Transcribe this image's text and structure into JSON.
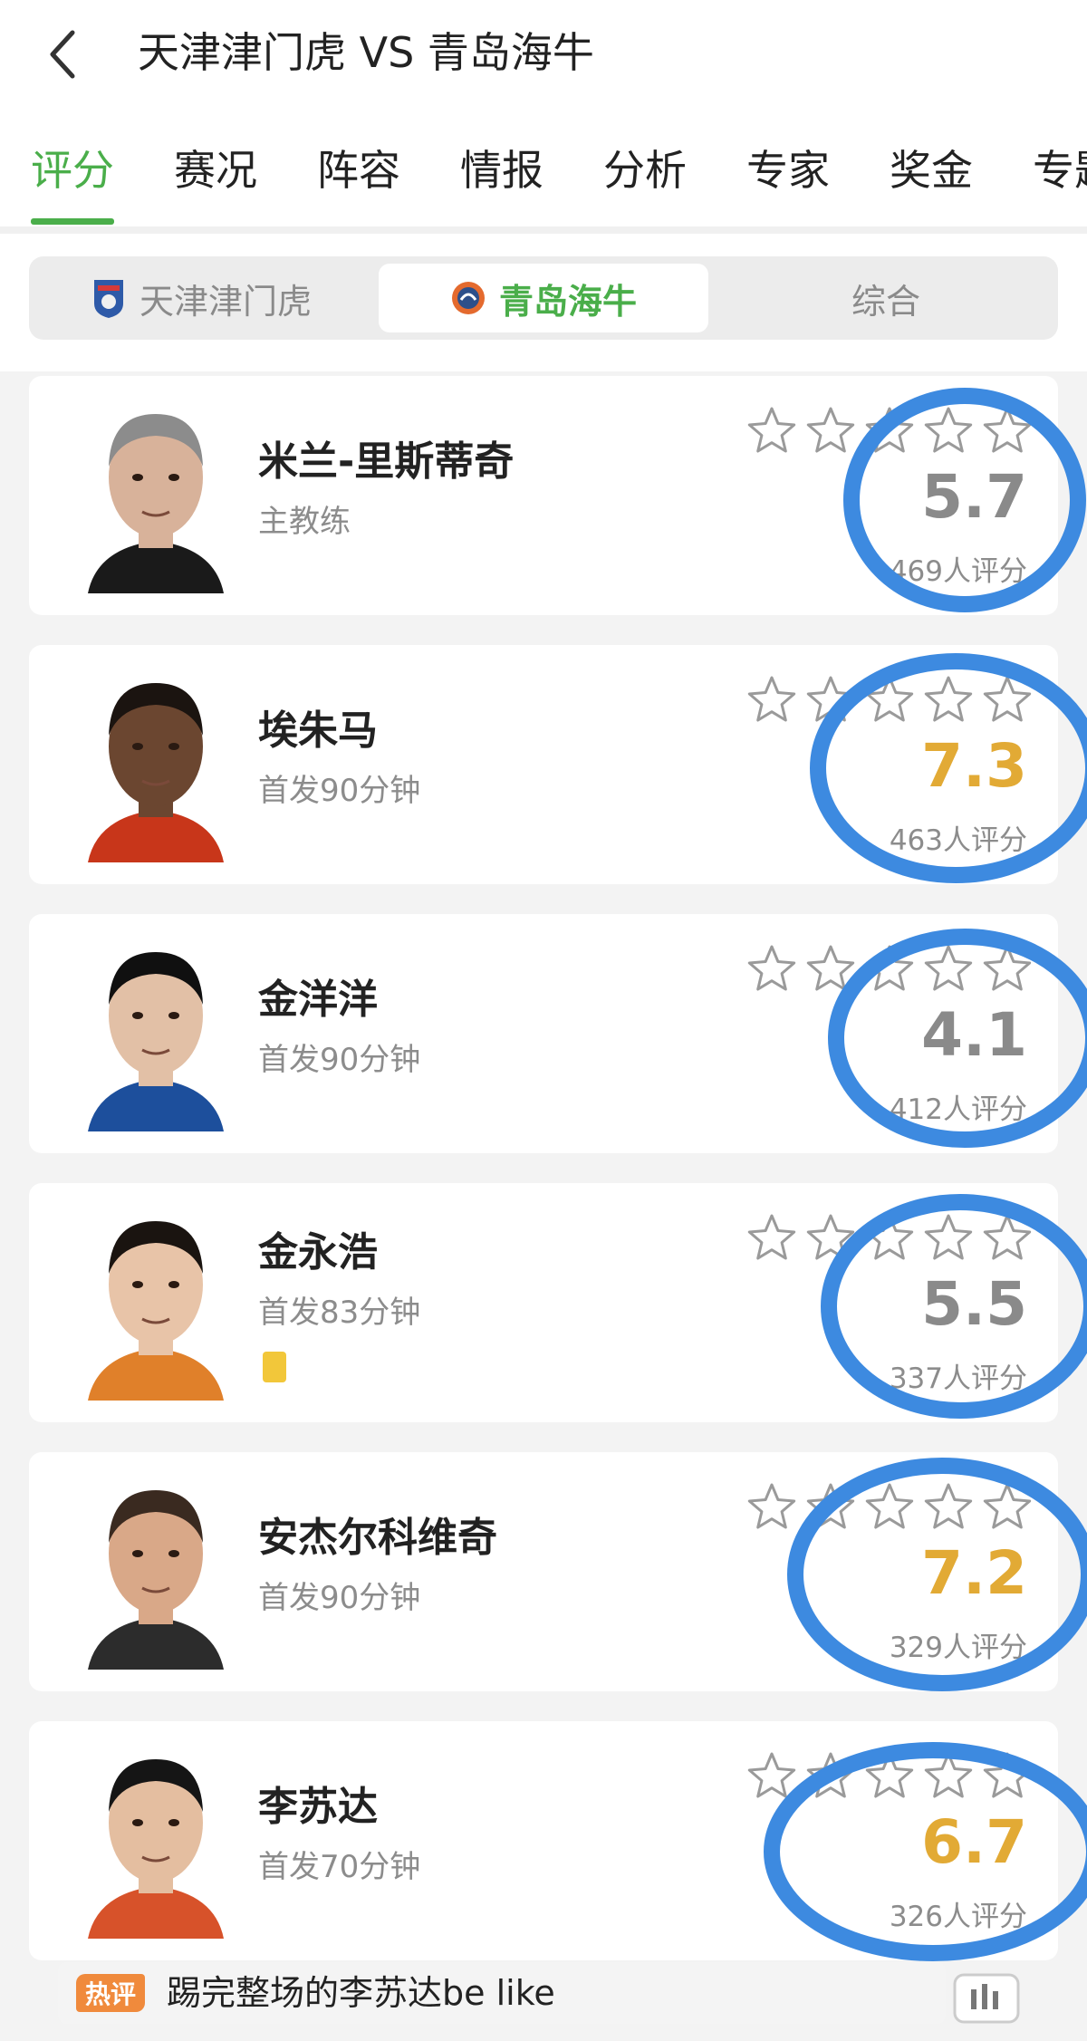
{
  "header": {
    "title": "天津津门虎 VS 青岛海牛"
  },
  "tabs": [
    "评分",
    "赛况",
    "阵容",
    "情报",
    "分析",
    "专家",
    "奖金",
    "专题"
  ],
  "team_switch": {
    "items": [
      "天津津门虎",
      "青岛海牛",
      "综合"
    ],
    "selected": "青岛海牛"
  },
  "accent_color": "#4aae4a",
  "players": [
    {
      "name": "米兰-里斯蒂奇",
      "sub": "主教练",
      "score": "5.7",
      "count": "469人评分",
      "score_color": "#8a8a8a",
      "yellow_card": false
    },
    {
      "name": "埃朱马",
      "sub": "首发90分钟",
      "score": "7.3",
      "count": "463人评分",
      "score_color": "#e2aa35",
      "yellow_card": false
    },
    {
      "name": "金洋洋",
      "sub": "首发90分钟",
      "score": "4.1",
      "count": "412人评分",
      "score_color": "#8a8a8a",
      "yellow_card": false
    },
    {
      "name": "金永浩",
      "sub": "首发83分钟",
      "score": "5.5",
      "count": "337人评分",
      "score_color": "#8a8a8a",
      "yellow_card": true
    },
    {
      "name": "安杰尔科维奇",
      "sub": "首发90分钟",
      "score": "7.2",
      "count": "329人评分",
      "score_color": "#e2aa35",
      "yellow_card": false
    },
    {
      "name": "李苏达",
      "sub": "首发70分钟",
      "score": "6.7",
      "count": "326人评分",
      "score_color": "#e2aa35",
      "yellow_card": false
    }
  ],
  "hot_comment": {
    "badge": "热评",
    "text": "踢完整场的李苏达be like"
  }
}
